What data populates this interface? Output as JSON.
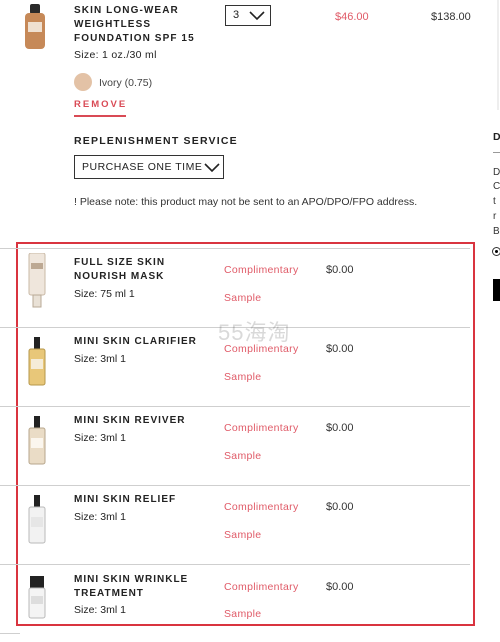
{
  "cart_item": {
    "title": "SKIN LONG-WEAR WEIGHTLESS FOUNDATION SPF 15",
    "size": "Size: 1 oz./30 ml",
    "shade": "Ivory (0.75)",
    "remove_label": "REMOVE",
    "quantity": "3",
    "unit_price": "$46.00",
    "total_price": "$138.00",
    "swatch_color": "#e3c2a6"
  },
  "replenishment": {
    "title": "REPLENISHMENT SERVICE",
    "selected": "PURCHASE ONE TIME",
    "note": "! Please note: this product may not be sent to an APO/DPO/FPO address."
  },
  "sidebar_fragment": {
    "heading": "D",
    "letters": [
      "D",
      "C",
      "t",
      "r",
      "B"
    ]
  },
  "samples": [
    {
      "title": "FULL SIZE SKIN NOURISH MASK",
      "size": "Size: 75 ml 1",
      "status": "Complimentary",
      "status2": "Sample",
      "price": "$0.00"
    },
    {
      "title": "MINI SKIN CLARIFIER",
      "size": "Size: 3ml 1",
      "status": "Complimentary",
      "status2": "Sample",
      "price": "$0.00"
    },
    {
      "title": "MINI SKIN REVIVER",
      "size": "Size: 3ml 1",
      "status": "Complimentary",
      "status2": "Sample",
      "price": "$0.00"
    },
    {
      "title": "MINI SKIN RELIEF",
      "size": "Size: 3ml 1",
      "status": "Complimentary",
      "status2": "Sample",
      "price": "$0.00"
    },
    {
      "title": "MINI SKIN WRINKLE TREATMENT",
      "size": "Size: 3ml 1",
      "status": "Complimentary",
      "status2": "Sample",
      "price": "$0.00"
    }
  ],
  "watermark": "55海淘",
  "colors": {
    "accent_red": "#e05b68",
    "highlight_frame": "#d9343f"
  }
}
